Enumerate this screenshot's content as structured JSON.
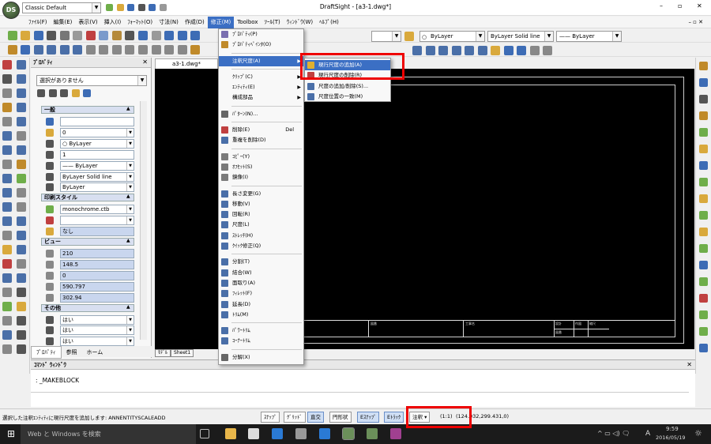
{
  "title": {
    "workspace": "Classic Default",
    "window_title": "DraftSight - [a3-1.dwg*]"
  },
  "window_controls": {
    "minimize": "–",
    "restore": "▫",
    "close": "✕",
    "doc_controls": "– ▫ ✕"
  },
  "menubar": [
    "ﾌｧｲﾙ(F)",
    "編集(E)",
    "表示(V)",
    "挿入(I)",
    "ﾌｫｰﾏｯﾄ(O)",
    "寸法(N)",
    "作成(D)",
    "修正(M)",
    "Toolbox",
    "ﾂｰﾙ(T)",
    "ｳｨﾝﾄﾞｳ(W)",
    "ﾍﾙﾌﾟ(H)"
  ],
  "active_menu": "修正(M)",
  "layer_toolbar": {
    "layer": "ByLayer",
    "linestyle": "ByLayer    Solid line",
    "lineweight": "—— ByLayer"
  },
  "doc_tab": "a3-1.dwg*",
  "properties_panel": {
    "title": "ﾌﾟﾛﾊﾟﾃｨ",
    "selection": "選択がありません",
    "sections": {
      "general": "一般",
      "print": "印刷スタイル",
      "view": "ビュー",
      "other": "その他"
    },
    "general_values": [
      "",
      "0",
      "○ ByLayer",
      "1",
      "—— ByLayer",
      "ByLayer    Solid line",
      "ByLayer"
    ],
    "print_values": [
      "monochrome.ctb",
      "",
      "なし"
    ],
    "view_values": [
      "210",
      "148.5",
      "0",
      "590.797",
      "302.94"
    ],
    "other_values": [
      "はい",
      "はい",
      "はい"
    ],
    "tabs": [
      "ﾌﾟﾛﾊﾟﾃｨ",
      "参照",
      "ホーム"
    ]
  },
  "modify_menu": [
    {
      "label": "ﾌﾟﾛﾊﾟﾃｨ(P)",
      "color": "#7a6fb0"
    },
    {
      "label": "ﾌﾟﾛﾊﾟﾃｨﾍﾟｲﾝﾀ(O)",
      "color": "#c08a2a"
    },
    {
      "sep": true
    },
    {
      "label": "注釈尺度(A)",
      "highlight": true,
      "submenu": true
    },
    {
      "sep": true
    },
    {
      "label": "ｸﾘｯﾌﾟ(C)",
      "submenu": true
    },
    {
      "label": "ｴﾝﾃｨﾃｨ(E)",
      "submenu": true
    },
    {
      "label": "構成部品",
      "submenu": true
    },
    {
      "sep": true
    },
    {
      "label": "ﾊﾟﾀｰﾝ(N)...",
      "color": "#666"
    },
    {
      "sep": true
    },
    {
      "label": "削除(E)",
      "shortcut": "Del",
      "color": "#c04040"
    },
    {
      "label": "重複を削除(D)",
      "color": "#4a6fa8"
    },
    {
      "sep": true
    },
    {
      "label": "ｺﾋﾟｰ(Y)",
      "color": "#7a7a7a"
    },
    {
      "label": "ｵﾌｾｯﾄ(S)",
      "color": "#7a7a7a"
    },
    {
      "label": "鏡像(I)",
      "color": "#7a7a7a"
    },
    {
      "sep": true
    },
    {
      "label": "長さ変更(G)",
      "color": "#4a6fa8"
    },
    {
      "label": "移動(V)",
      "color": "#4a6fa8"
    },
    {
      "label": "回転(R)",
      "color": "#4a6fa8"
    },
    {
      "label": "尺度(L)",
      "color": "#4a6fa8"
    },
    {
      "label": "ｽﾄﾚｯﾁ(H)",
      "color": "#4a6fa8"
    },
    {
      "label": "ｸｲｯｸ修正(Q)",
      "color": "#4a6fa8"
    },
    {
      "sep": true
    },
    {
      "label": "分割(T)",
      "color": "#4a6fa8"
    },
    {
      "label": "結合(W)",
      "color": "#4a6fa8"
    },
    {
      "label": "面取り(A)",
      "color": "#4a6fa8"
    },
    {
      "label": "ﾌｨﾚｯﾄ(F)",
      "color": "#4a6fa8"
    },
    {
      "label": "延長(D)",
      "color": "#4a6fa8"
    },
    {
      "label": "ﾄﾘﾑ(M)",
      "color": "#4a6fa8"
    },
    {
      "sep": true
    },
    {
      "label": "ﾊﾟﾜｰﾄﾘﾑ",
      "color": "#4a6fa8"
    },
    {
      "label": "ｺｰﾅｰﾄﾘﾑ",
      "color": "#4a6fa8"
    },
    {
      "sep": true
    },
    {
      "label": "分解(X)",
      "color": "#666"
    }
  ],
  "annotation_submenu": [
    {
      "label": "現行尺度の追加(A)",
      "highlight": true,
      "color": "#e0b030"
    },
    {
      "label": "現行尺度の削除(R)",
      "color": "#c04040"
    },
    {
      "label": "尺度の追加/削除(S)...",
      "color": "#4a6fa8"
    },
    {
      "label": "尺度位置の一致(M)",
      "color": "#4a6fa8"
    }
  ],
  "bottom_tabs": [
    "ﾓﾃﾞﾙ",
    "Sheet1"
  ],
  "command": {
    "title": "ｺﾏﾝﾄﾞ ｳｨﾝﾄﾞｳ",
    "line": ": _MAKEBLOCK"
  },
  "status": {
    "message": "選択した注釈ｴﾝﾃｨﾃｨに現行尺度を追加します: ANNENTITYSCALEADD",
    "toggles": [
      "ｽﾅｯﾌﾟ",
      "ｸﾞﾘｯﾄﾞ",
      "直交",
      "円形状",
      "Eｽﾅｯﾌﾟ",
      "Eﾄﾗｯｸ"
    ],
    "annotation": "注釈",
    "scale": "(1:1)",
    "coords": "(124.932,299.431,0)"
  },
  "title_block": {
    "cells": [
      "図番",
      "工事名",
      "設計",
      "作図",
      "縮尺",
      "図番"
    ]
  },
  "taskbar": {
    "search": "Web と Windows を検索",
    "time": "9:59",
    "date": "2016/05/19",
    "lang": "A"
  }
}
